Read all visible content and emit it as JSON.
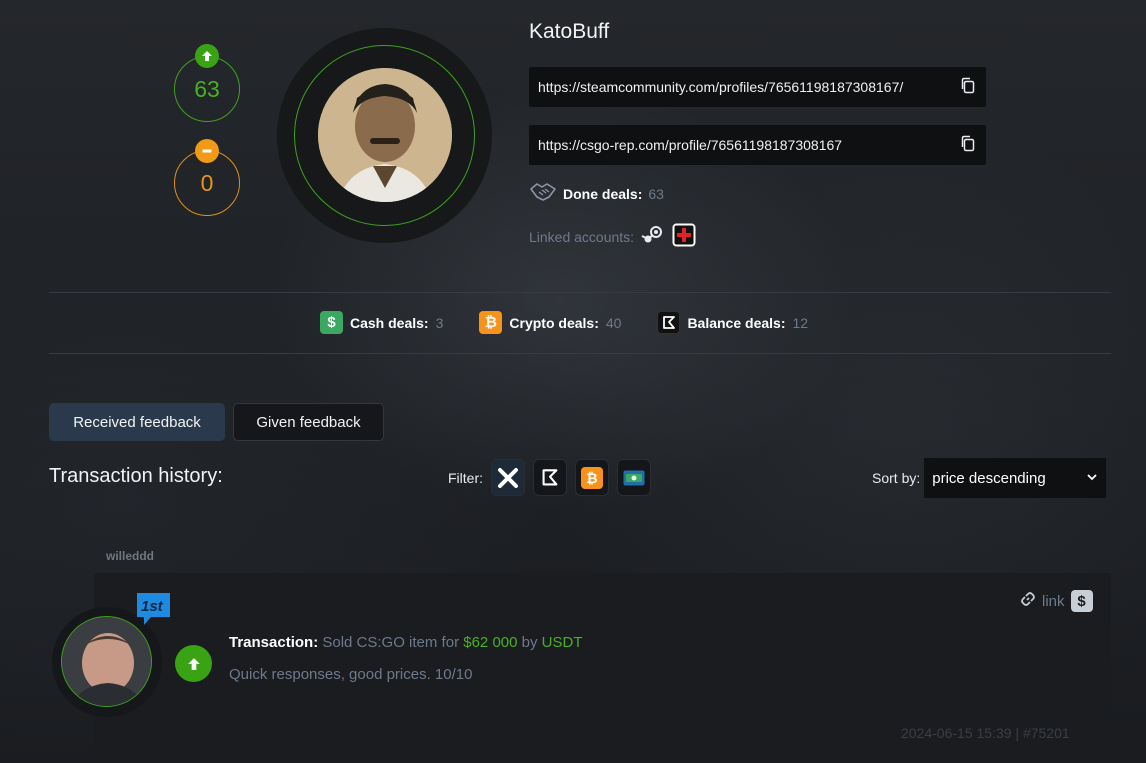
{
  "profile": {
    "username": "KatoBuff",
    "positive_count": "63",
    "neutral_count": "0",
    "steam_url": "https://steamcommunity.com/profiles/76561198187308167/",
    "rep_url": "https://csgo-rep.com/profile/76561198187308167",
    "done_deals_label": "Done deals:",
    "done_deals_value": "63",
    "linked_accounts_label": "Linked accounts:"
  },
  "deal_stats": [
    {
      "label": "Cash deals:",
      "value": "3",
      "icon": "cash-icon",
      "color": "#3aa860"
    },
    {
      "label": "Crypto deals:",
      "value": "40",
      "icon": "bitcoin-icon",
      "color": "#f7931a"
    },
    {
      "label": "Balance deals:",
      "value": "12",
      "icon": "balance-icon",
      "color": "#111111"
    }
  ],
  "tabs": {
    "received": "Received feedback",
    "given": "Given feedback"
  },
  "history": {
    "title": "Transaction history:",
    "filter_label": "Filter:",
    "sort_label": "Sort by:",
    "sort_value": "price descending"
  },
  "feedback": {
    "username": "willeddd",
    "badge": "1st",
    "tx_label": "Transaction:",
    "tx_prefix": "Sold CS:GO item for",
    "tx_amount": "$62 000",
    "tx_by": "by",
    "tx_currency": "USDT",
    "comment": "Quick responses, good prices. 10/10",
    "link_label": "link",
    "timestamp": "2024-06-15 15:39 | #75201"
  },
  "colors": {
    "positive": "#3aa314",
    "neutral": "#f09a18",
    "accent_tab": "#2a3a4c",
    "muted_text": "#6c7a8c"
  }
}
